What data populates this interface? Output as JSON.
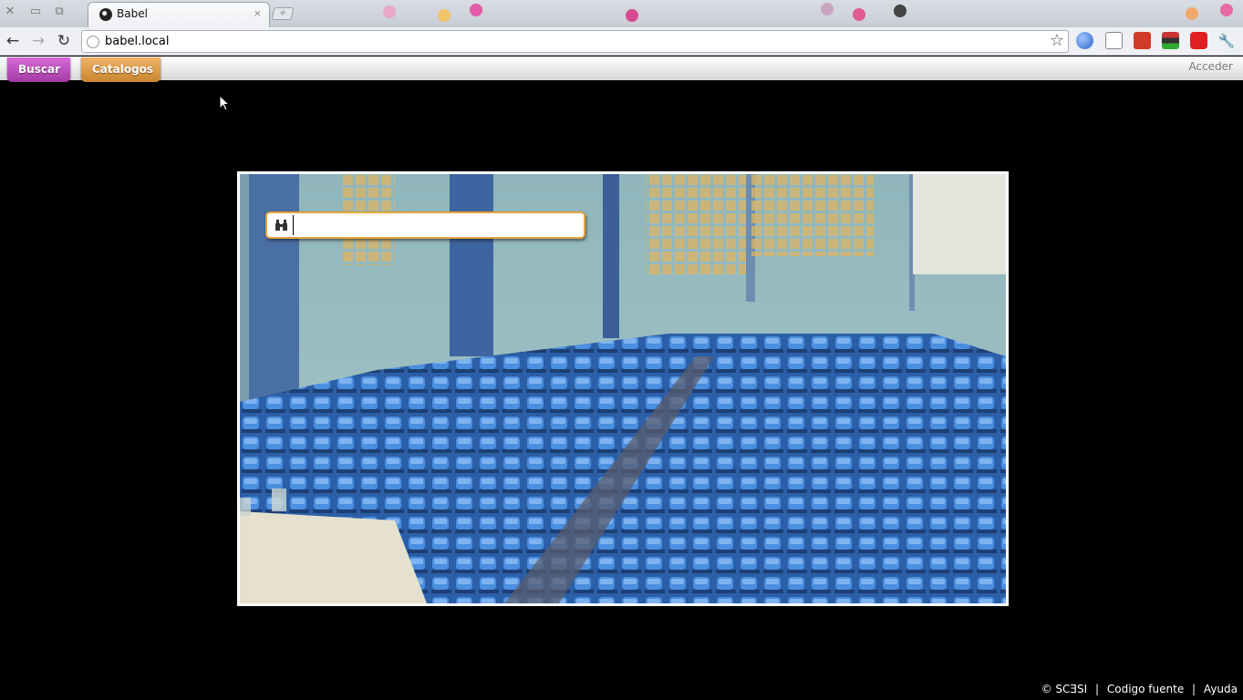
{
  "browser": {
    "tab_title": "Babel",
    "tab_close": "×",
    "url": "babel.local",
    "back_glyph": "←",
    "forward_glyph": "→",
    "reload_glyph": "↻",
    "star_glyph": "☆",
    "wrench_glyph": "🔧"
  },
  "app_bar": {
    "buscar_label": "Buscar",
    "catalogos_label": "Catalogos",
    "acceder_label": "Acceder"
  },
  "search": {
    "value": "",
    "placeholder": ""
  },
  "footer": {
    "copyright_label": "SCƎSI",
    "source_code_label": "Codigo fuente",
    "help_label": "Ayuda",
    "separator": "|"
  },
  "colors": {
    "buscar": "#b84bbb",
    "catalogos": "#dd9a48",
    "search_border": "#e3a43c",
    "page_background": "#000000"
  }
}
